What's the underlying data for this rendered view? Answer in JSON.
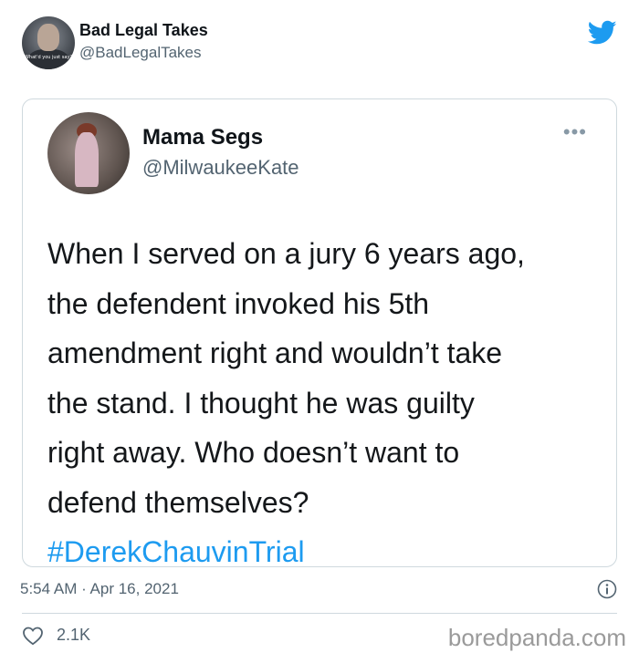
{
  "outer_tweet": {
    "display_name": "Bad Legal Takes",
    "handle": "@BadLegalTakes",
    "avatar_caption": "What'd you just say?",
    "timestamp": "5:54 AM · Apr 16, 2021",
    "like_count": "2.1K"
  },
  "quoted_tweet": {
    "display_name": "Mama Segs",
    "handle": "@MilwaukeeKate",
    "more_label": "•••",
    "body_lines": [
      "When I served on a jury 6 years ago,",
      "the defendent invoked his 5th",
      "amendment right and wouldn’t take",
      "the stand. I thought he was guilty",
      "right away. Who doesn’t want to",
      "defend themselves?"
    ],
    "hashtag": "#DerekChauvinTrial"
  },
  "watermark": "boredpanda.com",
  "colors": {
    "twitter_blue": "#1d9bf0",
    "secondary_text": "#536471",
    "border": "#cfd9de"
  },
  "icons": {
    "brand": "twitter-bird-icon",
    "info": "info-circle-icon",
    "like": "heart-outline-icon",
    "more": "more-dots-icon"
  }
}
